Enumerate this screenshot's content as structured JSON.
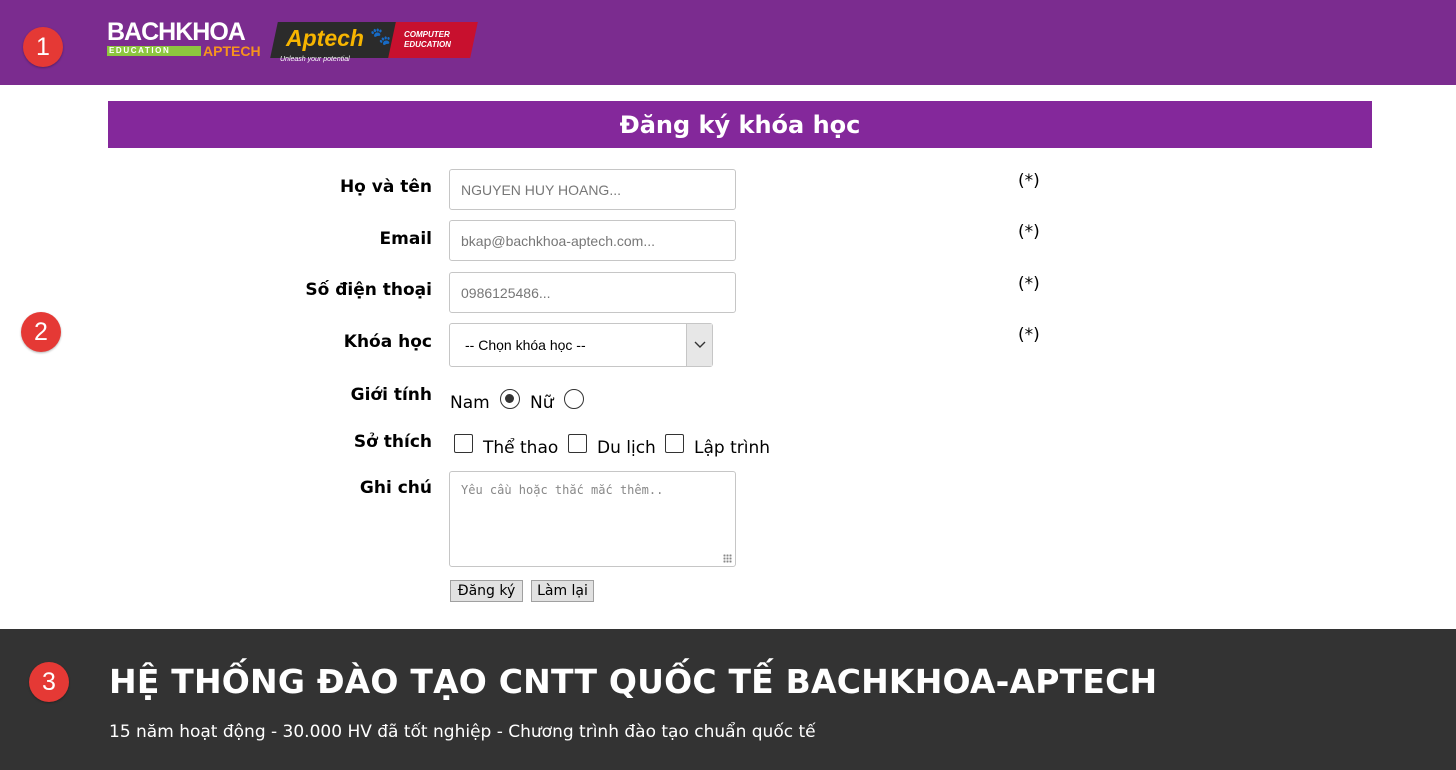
{
  "markers": [
    "1",
    "2",
    "3"
  ],
  "header": {
    "logo_bachkhoa": {
      "main": "BACHKHOA",
      "education": "EDUCATION",
      "aptech": "APTECH"
    },
    "logo_aptech": {
      "word": "Aptech",
      "computer": "COMPUTER",
      "education": "EDUCATION",
      "tagline": "Unleash your potential"
    },
    "colors": {
      "background": "#7b2c8f"
    }
  },
  "form": {
    "title": "Đăng ký khóa học",
    "title_bg": "#84289b",
    "fields": {
      "name": {
        "label": "Họ và tên",
        "placeholder": "NGUYEN HUY HOANG...",
        "required": "(*)"
      },
      "email": {
        "label": "Email",
        "placeholder": "bkap@bachkhoa-aptech.com...",
        "required": "(*)"
      },
      "phone": {
        "label": "Số điện thoại",
        "placeholder": "0986125486...",
        "required": "(*)"
      },
      "course": {
        "label": "Khóa học",
        "selected": "-- Chọn khóa học --",
        "required": "(*)"
      },
      "gender": {
        "label": "Giới tính",
        "options": [
          "Nam",
          "Nữ"
        ],
        "selected": "Nam"
      },
      "hobbies": {
        "label": "Sở thích",
        "options": [
          "Thể thao",
          "Du lịch",
          "Lập trình"
        ],
        "checked": []
      },
      "note": {
        "label": "Ghi chú",
        "placeholder": "Yêu cầu hoặc thắc mắc thêm.."
      }
    },
    "buttons": {
      "submit": "Đăng ký",
      "reset": "Làm lại"
    }
  },
  "footer": {
    "title": "HỆ THỐNG ĐÀO TẠO CNTT QUỐC TẾ BACHKHOA-APTECH",
    "subtitle": "15 năm hoạt động - 30.000 HV đã tốt nghiệp - Chương trình đào tạo chuẩn quốc tế",
    "background": "#333333"
  }
}
